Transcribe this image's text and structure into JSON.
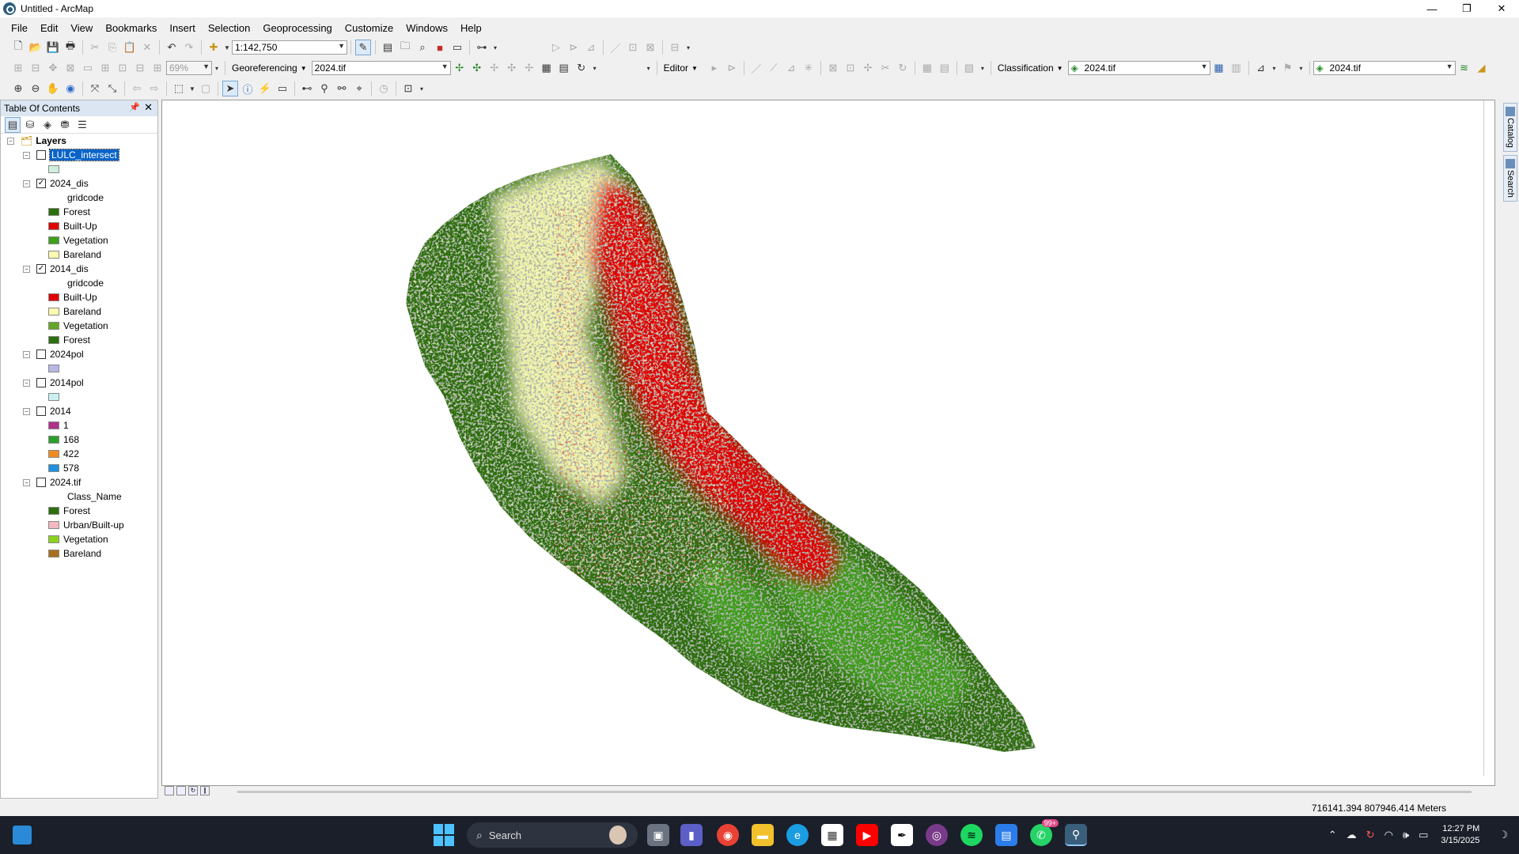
{
  "window": {
    "title": "Untitled - ArcMap",
    "minimize": "—",
    "maximize": "❐",
    "close": "✕"
  },
  "menu": [
    "File",
    "Edit",
    "View",
    "Bookmarks",
    "Insert",
    "Selection",
    "Geoprocessing",
    "Customize",
    "Windows",
    "Help"
  ],
  "toolbar": {
    "scale": "1:142,750",
    "zoom_percent": "69%",
    "georeferencing_label": "Georeferencing",
    "georef_layer": "2024.tif",
    "editor_label": "Editor",
    "classification_label": "Classification",
    "classification_layer": "2024.tif",
    "image_layer": "2024.tif"
  },
  "toc": {
    "title": "Table Of Contents",
    "root": "Layers",
    "layers": [
      {
        "name": "LULC_intersect",
        "checked": false,
        "selected": true,
        "field": "",
        "classes": [
          {
            "label": "",
            "color": "#cfeede"
          }
        ]
      },
      {
        "name": "2024_dis",
        "checked": true,
        "selected": false,
        "field": "gridcode",
        "classes": [
          {
            "label": "Forest",
            "color": "#2d6e0e"
          },
          {
            "label": "Built-Up",
            "color": "#e00000"
          },
          {
            "label": "Vegetation",
            "color": "#3fa01a"
          },
          {
            "label": "Bareland",
            "color": "#fafab0"
          }
        ]
      },
      {
        "name": "2014_dis",
        "checked": true,
        "selected": false,
        "field": "gridcode",
        "classes": [
          {
            "label": "Built-Up",
            "color": "#e00000"
          },
          {
            "label": "Bareland",
            "color": "#fafab0"
          },
          {
            "label": "Vegetation",
            "color": "#64a626"
          },
          {
            "label": "Forest",
            "color": "#2d6e0e"
          }
        ]
      },
      {
        "name": "2024pol",
        "checked": false,
        "selected": false,
        "field": "",
        "classes": [
          {
            "label": "",
            "color": "#b8b8e6"
          }
        ]
      },
      {
        "name": "2014pol",
        "checked": false,
        "selected": false,
        "field": "",
        "classes": [
          {
            "label": "",
            "color": "#c8f0f0"
          }
        ]
      },
      {
        "name": "2014",
        "checked": false,
        "selected": false,
        "field": "",
        "classes": [
          {
            "label": "1",
            "color": "#b0308a"
          },
          {
            "label": "168",
            "color": "#2aa02a"
          },
          {
            "label": "422",
            "color": "#f08c1e"
          },
          {
            "label": "578",
            "color": "#2090e0"
          }
        ]
      },
      {
        "name": "2024.tif",
        "checked": false,
        "selected": false,
        "field": "Class_Name",
        "classes": [
          {
            "label": "Forest",
            "color": "#2d6e0e"
          },
          {
            "label": "Urban/Built-up",
            "color": "#f4b8c0"
          },
          {
            "label": "Vegetation",
            "color": "#8cd21e"
          },
          {
            "label": "Bareland",
            "color": "#a8701e"
          }
        ]
      }
    ]
  },
  "dock": {
    "catalog": "Catalog",
    "search": "Search"
  },
  "status": {
    "coordinates": "716141.394  807946.414 Meters"
  },
  "taskbar": {
    "search_placeholder": "Search",
    "whatsapp_badge": "99+",
    "time": "12:27 PM",
    "date": "3/15/2025"
  },
  "colors": {
    "forest": "#2d6e0e",
    "built_up": "#e00000",
    "vegetation": "#3fa01a",
    "bareland": "#fafab0",
    "mixed_gray": "#6b7268"
  }
}
